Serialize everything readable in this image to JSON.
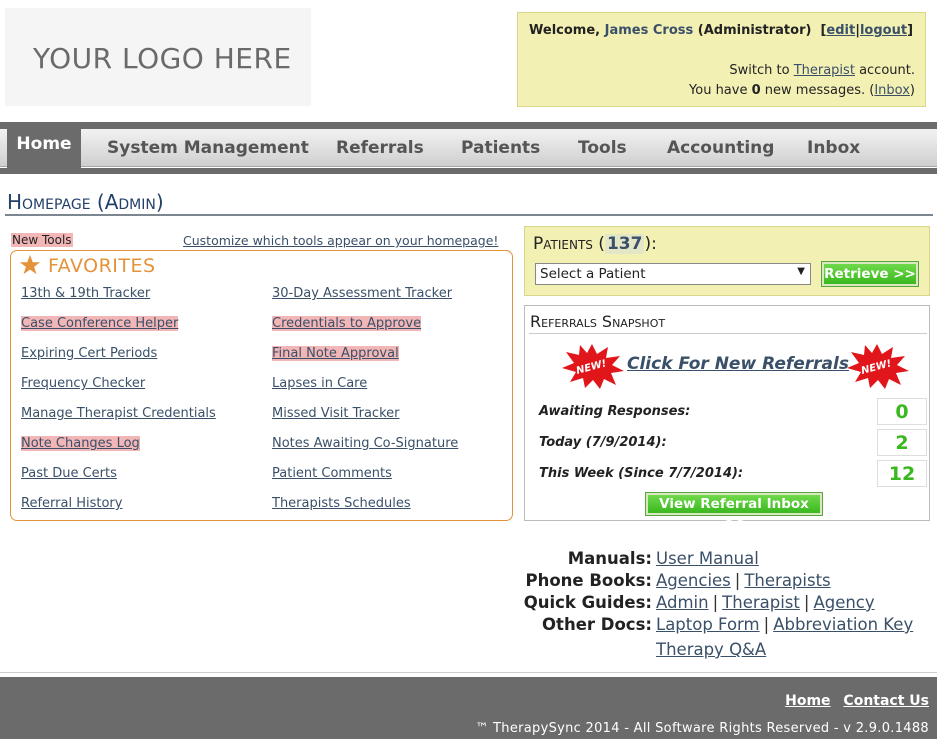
{
  "logo": {
    "text": "YOUR LOGO HERE"
  },
  "welcome": {
    "prefix": "Welcome,",
    "user_name": "James Cross",
    "role": "(Administrator)",
    "edit": "edit",
    "logout": "logout",
    "switch_prefix": "Switch to",
    "switch_link": "Therapist",
    "switch_suffix": "account.",
    "messages_prefix": "You have",
    "messages_count": "0",
    "messages_suffix": "new messages. (",
    "inbox_link": "Inbox",
    "messages_close": ")"
  },
  "nav": {
    "home": "Home",
    "items": [
      "System Management",
      "Referrals",
      "Patients",
      "Tools",
      "Accounting",
      "Inbox"
    ]
  },
  "page_title": "Homepage (Admin)",
  "tools": {
    "new_tools_label": "New Tools",
    "customize_link": "Customize which tools appear on your homepage!",
    "favorites_title": "FAVORITES",
    "left": [
      {
        "label": "13th & 19th Tracker",
        "new": false
      },
      {
        "label": "Case Conference Helper",
        "new": true
      },
      {
        "label": "Expiring Cert Periods",
        "new": false
      },
      {
        "label": "Frequency Checker",
        "new": false
      },
      {
        "label": "Manage Therapist Credentials",
        "new": false
      },
      {
        "label": "Note Changes Log",
        "new": true
      },
      {
        "label": "Past Due Certs",
        "new": false
      },
      {
        "label": "Referral History",
        "new": false
      }
    ],
    "right": [
      {
        "label": "30-Day Assessment Tracker",
        "new": false
      },
      {
        "label": "Credentials to Approve",
        "new": true
      },
      {
        "label": "Final Note Approval",
        "new": true
      },
      {
        "label": "Lapses in Care",
        "new": false
      },
      {
        "label": "Missed Visit Tracker",
        "new": false
      },
      {
        "label": "Notes Awaiting Co-Signature",
        "new": false
      },
      {
        "label": "Patient Comments",
        "new": false
      },
      {
        "label": "Therapists Schedules",
        "new": false
      }
    ]
  },
  "patients": {
    "label": "Patients",
    "count": "137",
    "select_value": "Select a Patient",
    "retrieve_button": "Retrieve >>"
  },
  "referrals": {
    "title": "Referrals Snapshot",
    "burst_text": "NEW!",
    "click_link": "Click For New Referrals",
    "rows": [
      {
        "label": "Awaiting Responses:",
        "count": "0"
      },
      {
        "label": "Today (7/9/2014):",
        "count": "2"
      },
      {
        "label": "This Week (Since 7/7/2014):",
        "count": "12"
      }
    ],
    "view_inbox_button": "View Referral Inbox >>"
  },
  "docs": {
    "manuals_label": "Manuals:",
    "manuals_links": [
      "User Manual"
    ],
    "phone_books_label": "Phone Books:",
    "phone_books_links": [
      "Agencies",
      "Therapists"
    ],
    "quick_guides_label": "Quick Guides:",
    "quick_guides_links": [
      "Admin",
      "Therapist",
      "Agency"
    ],
    "other_docs_label": "Other Docs:",
    "other_docs_links": [
      "Laptop Form",
      "Abbreviation Key",
      "Therapy Q&A"
    ],
    "separator": "|"
  },
  "footer": {
    "home_link": "Home",
    "contact_link": "Contact Us",
    "copyright": "™ TherapySync 2014 - All Software Rights Reserved - v 2.9.0.1488"
  },
  "colors": {
    "accent_orange": "#e4933a",
    "new_highlight": "#f3b6b6",
    "welcome_bg": "#f3f0b4",
    "nav_dark": "#6b6b6b",
    "button_green": "#3ab81f",
    "link_blue": "#3a5068"
  }
}
